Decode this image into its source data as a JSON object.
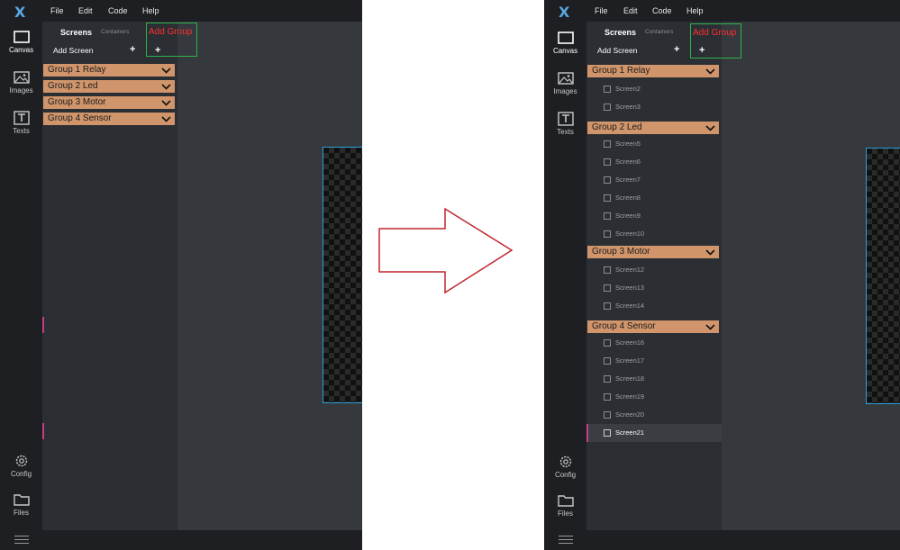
{
  "app": {
    "logo": "X",
    "menu": [
      "File",
      "Edit",
      "Code",
      "Help"
    ],
    "sidebar": [
      {
        "label": "Canvas",
        "icon": "canvas-icon"
      },
      {
        "label": "Images",
        "icon": "image-icon"
      },
      {
        "label": "Texts",
        "icon": "text-icon"
      },
      {
        "label": "Config",
        "icon": "gear-icon"
      },
      {
        "label": "Files",
        "icon": "folder-icon"
      }
    ],
    "tabs": {
      "screens": "Screens",
      "containers": "Containers"
    },
    "add_screen": "Add Screen",
    "plus": "+",
    "add_group": "Add Group"
  },
  "before": {
    "groups": [
      {
        "label": "Group 1  Relay"
      },
      {
        "label": "Group 2  Led"
      },
      {
        "label": "Group 3  Motor"
      },
      {
        "label": "Group 4  Sensor"
      }
    ]
  },
  "after": {
    "groups": [
      {
        "label": "Group 1  Relay",
        "screens": [
          "Screen2",
          "Screen3"
        ]
      },
      {
        "label": "Group 2  Led",
        "screens": [
          "Screen5",
          "Screen6",
          "Screen7",
          "Screen8",
          "Screen9",
          "Screen10"
        ]
      },
      {
        "label": "Group 3  Motor",
        "screens": [
          "Screen12",
          "Screen13",
          "Screen14"
        ]
      },
      {
        "label": "Group 4  Sensor",
        "screens": [
          "Screen16",
          "Screen17",
          "Screen18",
          "Screen19",
          "Screen20",
          "Screen21"
        ]
      }
    ],
    "active_screen": "Screen21"
  },
  "colors": {
    "accent_group": "#d0956b",
    "highlight": "#2fb34a",
    "annotation": "#ff3030",
    "canvas_border": "#2b9fd8",
    "arrow": "#c0272d"
  }
}
